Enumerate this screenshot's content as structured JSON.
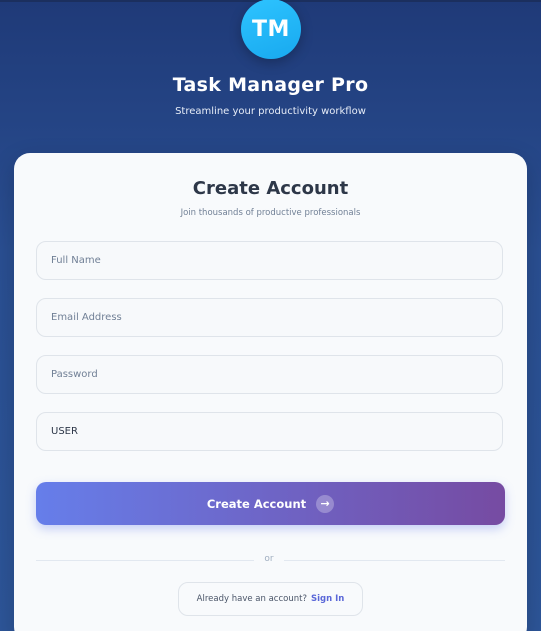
{
  "brand": {
    "logo_text": "TM",
    "title": "Task Manager Pro",
    "subtitle": "Streamline your productivity workflow"
  },
  "form": {
    "title": "Create Account",
    "subtitle": "Join thousands of productive professionals",
    "fields": {
      "full_name": {
        "placeholder": "Full Name",
        "value": ""
      },
      "email": {
        "placeholder": "Email Address",
        "value": ""
      },
      "password": {
        "placeholder": "Password",
        "value": ""
      },
      "role": {
        "value": "USER"
      }
    },
    "submit_label": "Create Account",
    "submit_icon": "arrow-right-icon",
    "submit_icon_glyph": "→",
    "divider_text": "or",
    "signin_prompt": "Already have an account?",
    "signin_link": "Sign In"
  },
  "colors": {
    "accent_start": "#667eea",
    "accent_end": "#764ba2",
    "logo": "#1fb6f5",
    "background": "#2a4f92"
  }
}
